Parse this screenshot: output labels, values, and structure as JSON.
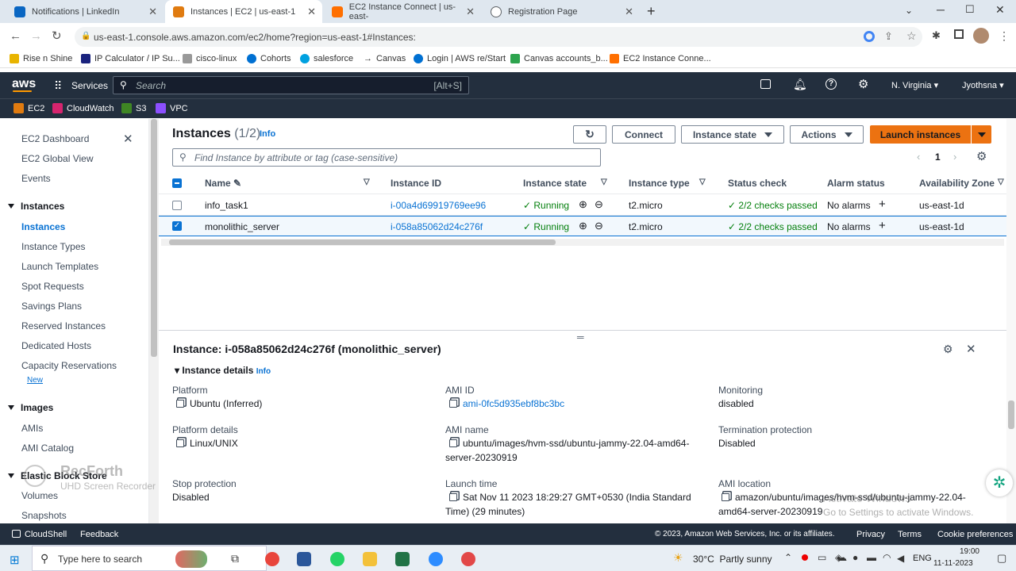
{
  "browser": {
    "tabs": [
      {
        "title": "Notifications | LinkedIn",
        "color": "#0a66c2"
      },
      {
        "title": "Instances | EC2 | us-east-1",
        "color": "#e07b10"
      },
      {
        "title": "EC2 Instance Connect | us-east-",
        "color": "#ff6f00"
      },
      {
        "title": "Registration Page",
        "color": "#5f6368"
      }
    ],
    "url": "us-east-1.console.aws.amazon.com/ec2/home?region=us-east-1#Instances:",
    "bookmarks": [
      "Rise n Shine",
      "IP Calculator / IP Su...",
      "cisco-linux",
      "Cohorts",
      "salesforce",
      "Canvas",
      "Login | AWS re/Start",
      "Canvas accounts_b...",
      "EC2 Instance Conne..."
    ]
  },
  "aws": {
    "logo": "aws",
    "services": "Services",
    "search_placeholder": "Search",
    "search_shortcut": "[Alt+S]",
    "region": "N. Virginia",
    "user": "Jyothsna",
    "favorites": [
      "EC2",
      "CloudWatch",
      "S3",
      "VPC"
    ]
  },
  "sidebar": {
    "items_top": [
      "EC2 Dashboard",
      "EC2 Global View",
      "Events"
    ],
    "section_instances": "Instances",
    "instances_items": [
      "Instances",
      "Instance Types",
      "Launch Templates",
      "Spot Requests",
      "Savings Plans",
      "Reserved Instances",
      "Dedicated Hosts",
      "Capacity Reservations"
    ],
    "new_badge": "New",
    "section_images": "Images",
    "images_items": [
      "AMIs",
      "AMI Catalog"
    ],
    "section_ebs": "Elastic Block Store",
    "ebs_items": [
      "Volumes",
      "Snapshots"
    ]
  },
  "instances": {
    "title": "Instances",
    "count": "(1/2)",
    "info": "Info",
    "connect": "Connect",
    "instance_state": "Instance state",
    "actions": "Actions",
    "launch": "Launch instances",
    "filter_placeholder": "Find Instance by attribute or tag (case-sensitive)",
    "page": "1",
    "columns": [
      "Name",
      "Instance ID",
      "Instance state",
      "Instance type",
      "Status check",
      "Alarm status",
      "Availability Zone"
    ],
    "rows": [
      {
        "name": "info_task1",
        "id": "i-00a4d69919769ee96",
        "state": "Running",
        "type": "t2.micro",
        "status": "2/2 checks passed",
        "alarm": "No alarms",
        "az": "us-east-1d",
        "selected": false
      },
      {
        "name": "monolithic_server",
        "id": "i-058a85062d24c276f",
        "state": "Running",
        "type": "t2.micro",
        "status": "2/2 checks passed",
        "alarm": "No alarms",
        "az": "us-east-1d",
        "selected": true
      }
    ]
  },
  "details": {
    "title": "Instance: i-058a85062d24c276f (monolithic_server)",
    "section": "Instance details",
    "info": "Info",
    "platform_label": "Platform",
    "platform": "Ubuntu (Inferred)",
    "ami_id_label": "AMI ID",
    "ami_id": "ami-0fc5d935ebf8bc3bc",
    "monitoring_label": "Monitoring",
    "monitoring": "disabled",
    "platform_details_label": "Platform details",
    "platform_details": "Linux/UNIX",
    "ami_name_label": "AMI name",
    "ami_name": "ubuntu/images/hvm-ssd/ubuntu-jammy-22.04-amd64-server-20230919",
    "termination_label": "Termination protection",
    "termination": "Disabled",
    "stop_label": "Stop protection",
    "stop": "Disabled",
    "launch_label": "Launch time",
    "launch_time": "Sat Nov 11 2023 18:29:27 GMT+0530 (India Standard Time) (29 minutes)",
    "ami_location_label": "AMI location",
    "ami_location": "amazon/ubuntu/images/hvm-ssd/ubuntu-jammy-22.04-amd64-server-20230919"
  },
  "footer": {
    "cloudshell": "CloudShell",
    "feedback": "Feedback",
    "copyright": "© 2023, Amazon Web Services, Inc. or its affiliates.",
    "privacy": "Privacy",
    "terms": "Terms",
    "cookies": "Cookie preferences"
  },
  "taskbar": {
    "search": "Type here to search",
    "weather": "30°C  Partly sunny",
    "lang": "ENG",
    "time": "19:00",
    "date": "11-11-2023"
  },
  "watermarks": {
    "recorder_title": "RecForth",
    "recorder_sub": "UHD Screen Recorder",
    "activate_title": "Activate Windows",
    "activate_sub": "Go to Settings to activate Windows."
  }
}
